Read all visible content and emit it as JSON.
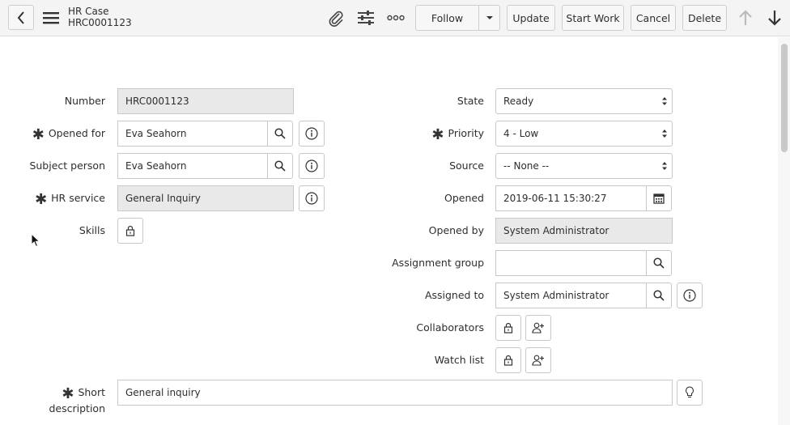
{
  "header": {
    "record_type": "HR Case",
    "record_number": "HRC0001123",
    "follow_label": "Follow",
    "update_label": "Update",
    "start_work_label": "Start Work",
    "cancel_label": "Cancel",
    "delete_label": "Delete"
  },
  "form": {
    "number": {
      "label": "Number",
      "value": "HRC0001123"
    },
    "opened_for": {
      "label": "Opened for",
      "value": "Eva Seahorn"
    },
    "subject_person": {
      "label": "Subject person",
      "value": "Eva Seahorn"
    },
    "hr_service": {
      "label": "HR service",
      "value": "General Inquiry"
    },
    "skills": {
      "label": "Skills"
    },
    "state": {
      "label": "State",
      "value": "Ready"
    },
    "priority": {
      "label": "Priority",
      "value": "4 - Low"
    },
    "source": {
      "label": "Source",
      "value": "-- None --"
    },
    "opened": {
      "label": "Opened",
      "value": "2019-06-11 15:30:27"
    },
    "opened_by": {
      "label": "Opened by",
      "value": "System Administrator"
    },
    "assignment_group": {
      "label": "Assignment group",
      "value": ""
    },
    "assigned_to": {
      "label": "Assigned to",
      "value": "System Administrator"
    },
    "collaborators": {
      "label": "Collaborators"
    },
    "watch_list": {
      "label": "Watch list"
    },
    "short_description": {
      "label_line1": "Short",
      "label_line2": "description",
      "value": "General inquiry"
    }
  },
  "required_marker": "✱"
}
